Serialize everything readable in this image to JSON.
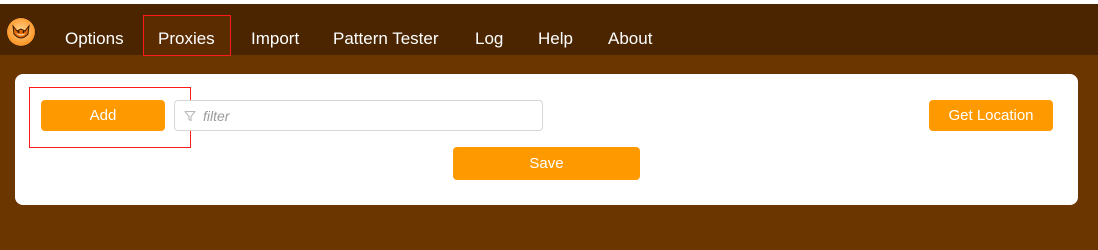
{
  "nav": {
    "items": [
      {
        "label": "Options"
      },
      {
        "label": "Proxies"
      },
      {
        "label": "Import"
      },
      {
        "label": "Pattern Tester"
      },
      {
        "label": "Log"
      },
      {
        "label": "Help"
      },
      {
        "label": "About"
      }
    ],
    "active": "Proxies"
  },
  "toolbar": {
    "add_label": "Add",
    "filter_placeholder": "filter",
    "filter_value": "",
    "get_location_label": "Get Location",
    "save_label": "Save"
  },
  "icons": {
    "logo": "foxyproxy-logo-icon",
    "filter": "funnel-icon"
  },
  "colors": {
    "nav_bg": "#4a2500",
    "page_bg": "#6b3600",
    "button": "#ff9900",
    "highlight": "#ff1a1a"
  }
}
